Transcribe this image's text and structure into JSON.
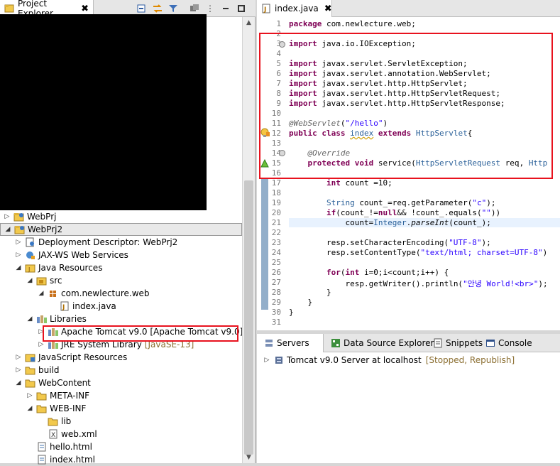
{
  "left_panel": {
    "tab_label": "Project Explorer",
    "close_glyph": "✖",
    "tree": [
      {
        "label": "WebPrj",
        "deco": "",
        "expanded": false,
        "icon": "project-icon"
      },
      {
        "label": "WebPrj2",
        "deco": "",
        "expanded": true,
        "icon": "project-icon"
      },
      {
        "label": "Deployment Descriptor: WebPrj2",
        "deco": "",
        "expanded": false,
        "icon": "deployment-descriptor-icon"
      },
      {
        "label": "JAX-WS Web Services",
        "deco": "",
        "expanded": false,
        "icon": "web-services-icon"
      },
      {
        "label": "Java Resources",
        "deco": "",
        "expanded": true,
        "icon": "java-resources-icon"
      },
      {
        "label": "src",
        "deco": "",
        "expanded": true,
        "icon": "source-folder-icon"
      },
      {
        "label": "com.newlecture.web",
        "deco": "",
        "expanded": true,
        "icon": "package-icon"
      },
      {
        "label": "index.java",
        "deco": "",
        "expanded": false,
        "icon": "java-file-icon"
      },
      {
        "label": "Libraries",
        "deco": "",
        "expanded": true,
        "icon": "libraries-icon"
      },
      {
        "label": "Apache Tomcat v9.0 [Apache Tomcat v9.0]",
        "deco": "",
        "expanded": false,
        "icon": "library-icon"
      },
      {
        "label": "JRE System Library",
        "deco": "[JavaSE-13]",
        "expanded": false,
        "icon": "library-icon"
      },
      {
        "label": "JavaScript Resources",
        "deco": "",
        "expanded": false,
        "icon": "javascript-resources-icon"
      },
      {
        "label": "build",
        "deco": "",
        "expanded": false,
        "icon": "folder-icon"
      },
      {
        "label": "WebContent",
        "deco": "",
        "expanded": true,
        "icon": "folder-icon"
      },
      {
        "label": "META-INF",
        "deco": "",
        "expanded": false,
        "icon": "folder-icon"
      },
      {
        "label": "WEB-INF",
        "deco": "",
        "expanded": true,
        "icon": "folder-icon"
      },
      {
        "label": "lib",
        "deco": "",
        "expanded": false,
        "icon": "folder-icon"
      },
      {
        "label": "web.xml",
        "deco": "",
        "expanded": false,
        "icon": "xml-file-icon"
      },
      {
        "label": "hello.html",
        "deco": "",
        "expanded": false,
        "icon": "html-file-icon"
      },
      {
        "label": "index.html",
        "deco": "",
        "expanded": false,
        "icon": "html-file-icon"
      }
    ]
  },
  "editor": {
    "tab_label": "index.java",
    "close_glyph": "✖",
    "line_numbers": [
      "1",
      "2",
      "3",
      "4",
      "5",
      "6",
      "7",
      "8",
      "9",
      "10",
      "11",
      "12",
      "13",
      "14",
      "15",
      "16",
      "17",
      "18",
      "19",
      "20",
      "21",
      "22",
      "23",
      "24",
      "25",
      "26",
      "27",
      "28",
      "29",
      "30",
      "31"
    ],
    "code": {
      "l1a": "package",
      "l1b": " com.newlecture.web;",
      "l3a": "import",
      "l3b": " java.io.IOException;",
      "l5a": "import",
      "l5b": " javax.servlet.ServletException;",
      "l6a": "import",
      "l6b": " javax.servlet.annotation.WebServlet;",
      "l7a": "import",
      "l7b": " javax.servlet.http.HttpServlet;",
      "l8a": "import",
      "l8b": " javax.servlet.http.HttpServletRequest;",
      "l9a": "import",
      "l9b": " javax.servlet.http.HttpServletResponse;",
      "l11a": "@WebServlet",
      "l11b": "(",
      "l11c": "\"/hello\"",
      "l11d": ")",
      "l12a": "public",
      "l12b": " ",
      "l12c": "class",
      "l12d": " ",
      "l12e": "index",
      "l12f": " ",
      "l12g": "extends",
      "l12h": " ",
      "l12i": "HttpServlet",
      "l12j": "{",
      "l14a": "    @Override",
      "l15a": "    ",
      "l15b": "protected",
      "l15c": " ",
      "l15d": "void",
      "l15e": " ",
      "l15f": "service",
      "l15g": "(",
      "l15h": "HttpServletRequest",
      "l15i": " ",
      "l15j": "req",
      "l15k": ", ",
      "l15l": "Http",
      "l17a": "        ",
      "l17b": "int",
      "l17c": " ",
      "l17d": "count",
      "l17e": " =10;",
      "l19a": "        ",
      "l19b": "String",
      "l19c": " ",
      "l19d": "count_",
      "l19e": "=",
      "l19f": "req",
      "l19g": ".getParameter(",
      "l19h": "\"c\"",
      "l19i": ");",
      "l20a": "        ",
      "l20b": "if",
      "l20c": "(",
      "l20d": "count_",
      "l20e": "!=",
      "l20f": "null",
      "l20g": "&& !",
      "l20h": "count_",
      "l20i": ".equals(",
      "l20j": "\"\"",
      "l20k": "))",
      "l21a": "            ",
      "l21b": "count",
      "l21c": "=",
      "l21d": "Integer",
      "l21e": ".",
      "l21f": "parseInt",
      "l21g": "(",
      "l21h": "count",
      "l21i": "_);",
      "l23a": "        ",
      "l23b": "resp",
      "l23c": ".setCharacterEncoding(",
      "l23d": "\"UTF-8\"",
      "l23e": ");",
      "l24a": "        ",
      "l24b": "resp",
      "l24c": ".setContentType(",
      "l24d": "\"text/html; charset=UTF-8\"",
      "l24e": ")",
      "l26a": "        ",
      "l26b": "for",
      "l26c": "(",
      "l26d": "int",
      "l26e": " ",
      "l26f": "i",
      "l26g": "=0;",
      "l26h": "i",
      "l26i": "<",
      "l26j": "count",
      "l26k": ";",
      "l26l": "i",
      "l26m": "++) {",
      "l27a": "            ",
      "l27b": "resp",
      "l27c": ".getWriter().println(",
      "l27d": "\"안녕 World!<br>\"",
      "l27e": ");",
      "l28a": "        }",
      "l29a": "    }",
      "l30a": "}"
    }
  },
  "bottom_panel": {
    "tabs": [
      {
        "label": "Servers",
        "icon": "servers-icon"
      },
      {
        "label": "Data Source Explorer",
        "icon": "data-source-icon"
      },
      {
        "label": "Snippets",
        "icon": "snippets-icon"
      },
      {
        "label": "Console",
        "icon": "console-icon"
      }
    ],
    "server_name": "Tomcat v9.0 Server at localhost",
    "server_status": "[Stopped, Republish]"
  },
  "colors": {
    "highlight_box": "#e8121e",
    "keyword": "#7f0055",
    "string": "#2a00ff",
    "annotation": "#646464"
  }
}
